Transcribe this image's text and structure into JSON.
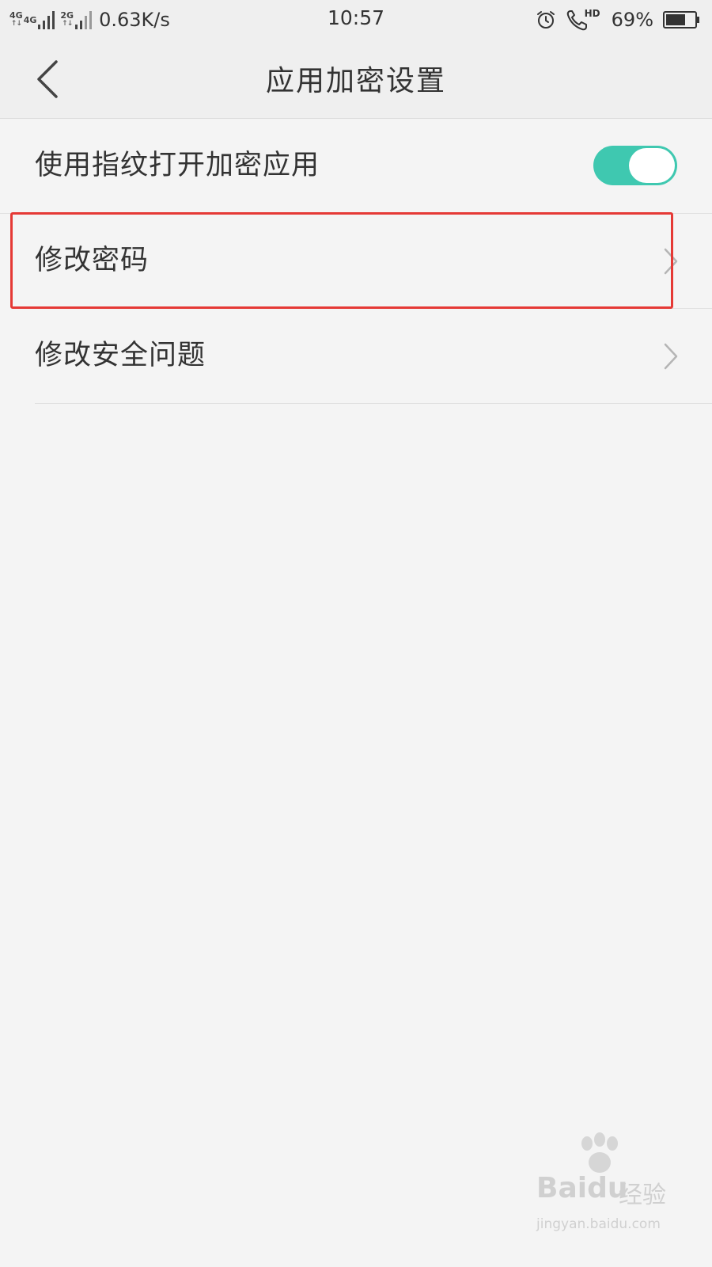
{
  "status_bar": {
    "net1": "4G",
    "net2": "4G",
    "net3": "2G",
    "speed": "0.63K/s",
    "time": "10:57",
    "call_hd": "HD",
    "battery_percent": "69%",
    "battery_level": 0.69
  },
  "header": {
    "title": "应用加密设置"
  },
  "settings": {
    "fingerprint": {
      "label": "使用指纹打开加密应用",
      "enabled": true,
      "accent": "#3fc8b0"
    },
    "change_password": {
      "label": "修改密码"
    },
    "change_security_question": {
      "label": "修改安全问题"
    }
  },
  "annotation": {
    "highlight_color": "#e53935"
  },
  "watermark": {
    "brand": "Baidu",
    "brand_cn": "经验",
    "url": "jingyan.baidu.com"
  }
}
